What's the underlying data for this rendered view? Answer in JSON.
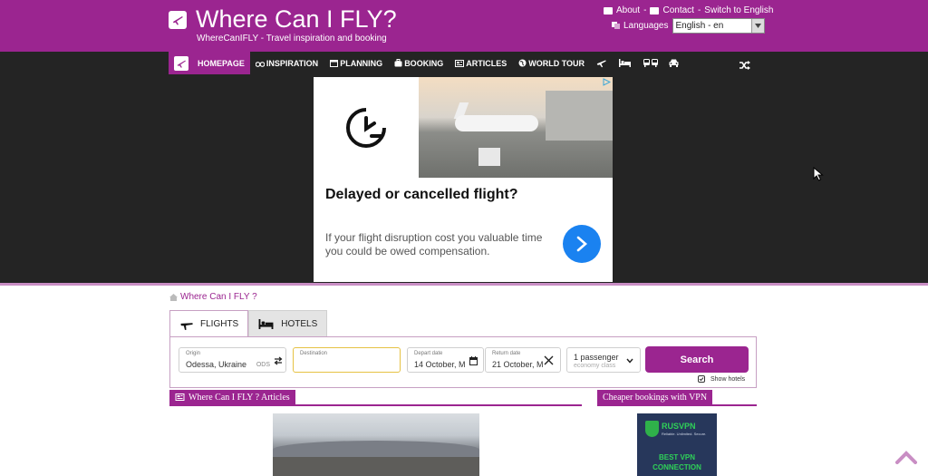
{
  "site": {
    "title": "Where Can I FLY?",
    "subtitle": "WhereCanIFLY - Travel inspiration and booking"
  },
  "top_links": {
    "about": "About",
    "dash": "-",
    "contact": "Contact",
    "dash2": "-",
    "switch": "Switch to English",
    "languages_label": "Languages",
    "language_value": "English - en"
  },
  "nav": {
    "home": "HOMEPAGE",
    "inspiration": "INSPIRATION",
    "planning": "PLANNING",
    "booking": "BOOKING",
    "articles": "ARTICLES",
    "world_tour": "WORLD TOUR",
    "icons": [
      "plane-icon",
      "bed-icon",
      "bus-icon",
      "car-icon",
      "shuffle-icon"
    ]
  },
  "ad": {
    "headline": "Delayed or cancelled flight?",
    "body": "If your flight disruption cost you valuable time you could be owed compensation."
  },
  "breadcrumb": {
    "label": "Where Can I FLY ?"
  },
  "tabs": [
    {
      "label": "FLIGHTS",
      "active": true
    },
    {
      "label": "HOTELS",
      "active": false
    }
  ],
  "search": {
    "origin_label": "Origin",
    "origin_value": "Odessa, Ukraine",
    "origin_code": "ODS",
    "destination_label": "Destination",
    "destination_value": "",
    "depart_label": "Depart date",
    "depart_value": "14 October, M",
    "return_label": "Return date",
    "return_value": "21 October, M",
    "passengers": "1 passenger",
    "cabin": "economy class",
    "search_label": "Search",
    "show_hotels": "Show hotels"
  },
  "sections": {
    "articles": "Where Can I FLY ? Articles",
    "vpn": "Cheaper bookings with VPN"
  },
  "vpn_ad": {
    "brand": "RUSVPN",
    "tagline": "Reliable. Unlimited. Secure.",
    "cta_line1": "BEST VPN",
    "cta_line2": "CONNECTION"
  },
  "colors": {
    "brand": "#9b2590",
    "dark_band": "#242424",
    "ad_button": "#1a82f0",
    "destination_border": "#e6c244"
  }
}
